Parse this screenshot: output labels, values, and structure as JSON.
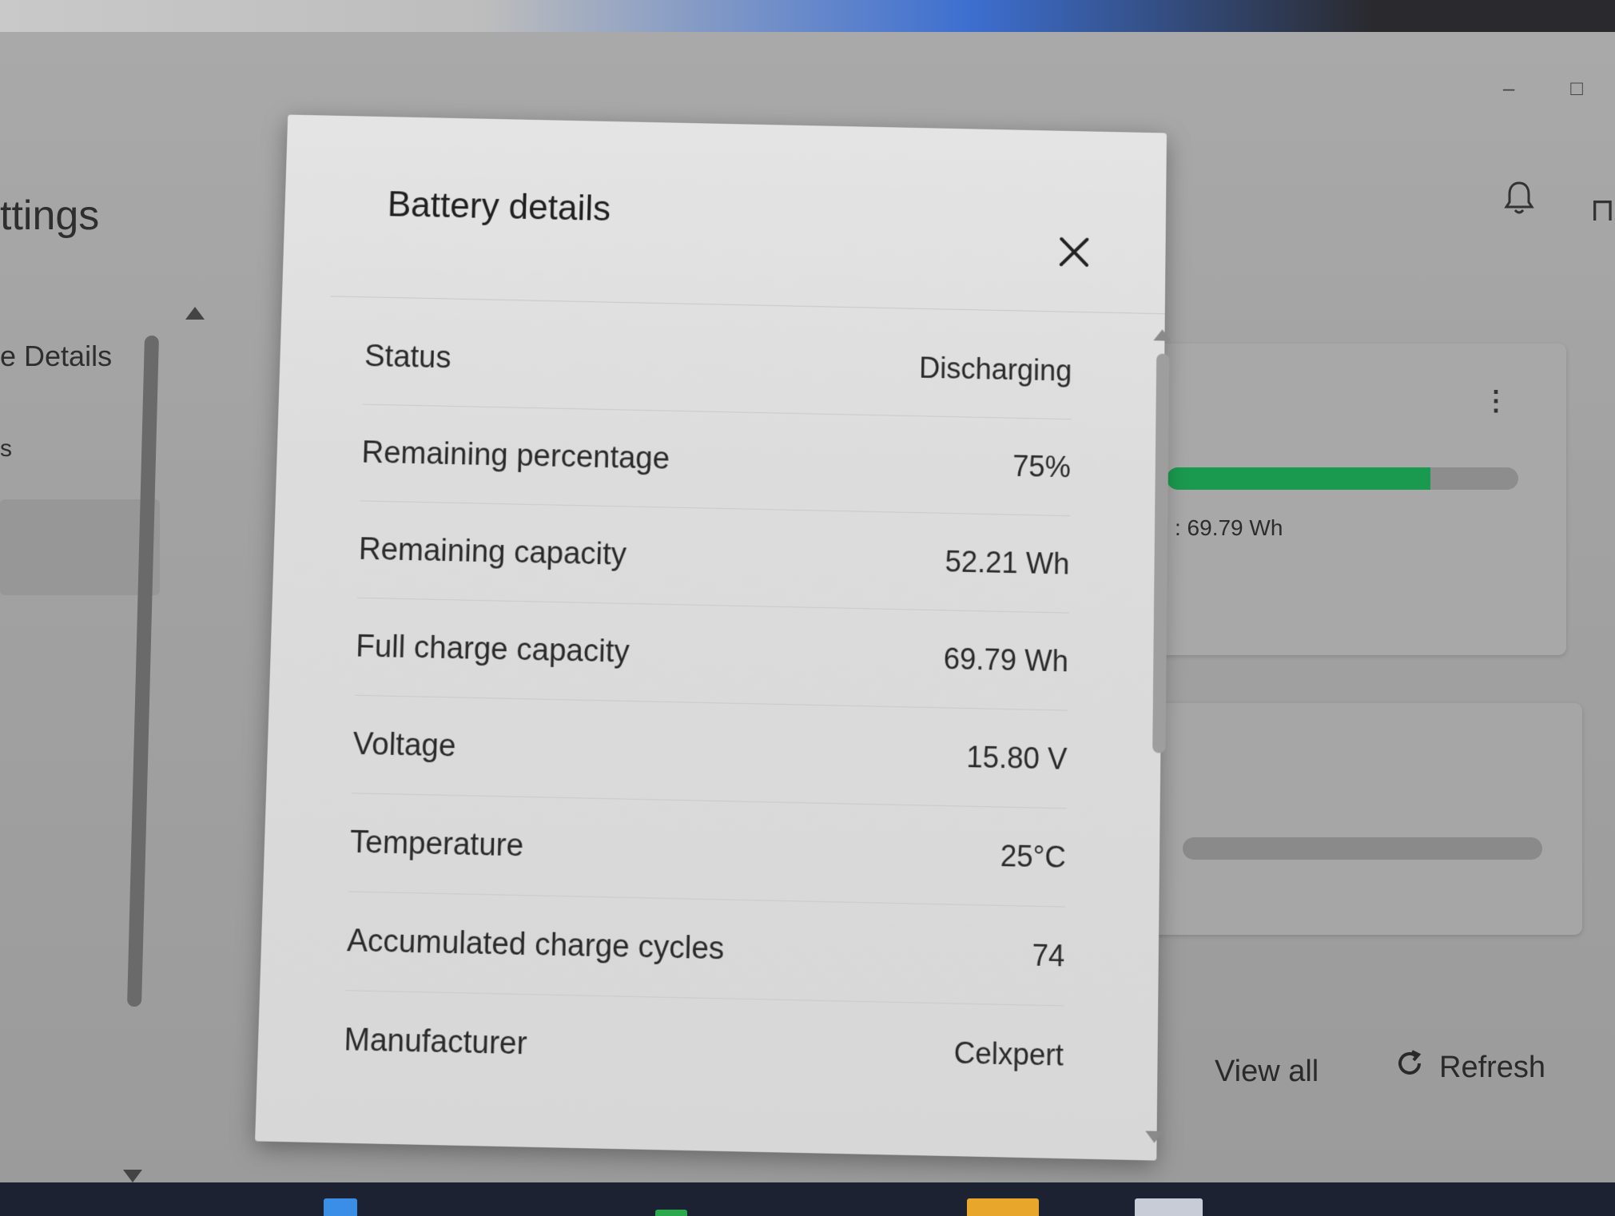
{
  "app": {
    "title_fragment": "ttings",
    "nav_item_fragment": "e Details",
    "nav_item2_fragment": "s"
  },
  "window": {
    "minimize_glyph": "–",
    "maximize_glyph": "□"
  },
  "right_panel": {
    "more_glyph": "⋮",
    "capacity_fragment": ": 69.79 Wh",
    "charge_fraction": 0.75,
    "view_all_label": "View all",
    "refresh_label": "Refresh",
    "accent_color": "#1a9a4e"
  },
  "dialog": {
    "title": "Battery details",
    "close_glyph": "×",
    "rows": [
      {
        "label": "Status",
        "value": "Discharging"
      },
      {
        "label": "Remaining percentage",
        "value": "75%"
      },
      {
        "label": "Remaining capacity",
        "value": "52.21 Wh"
      },
      {
        "label": "Full charge capacity",
        "value": "69.79 Wh"
      },
      {
        "label": "Voltage",
        "value": "15.80 V"
      },
      {
        "label": "Temperature",
        "value": "25°C"
      },
      {
        "label": "Accumulated charge cycles",
        "value": "74"
      },
      {
        "label": "Manufacturer",
        "value": "Celxpert"
      }
    ]
  },
  "icons": {
    "bell": "bell-icon",
    "close": "close-icon",
    "refresh": "refresh-icon",
    "more": "more-vertical-icon"
  }
}
